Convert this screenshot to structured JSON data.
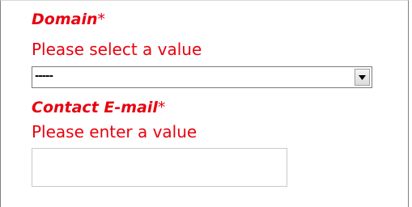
{
  "form": {
    "domain": {
      "label": "Domain",
      "required_mark": "*",
      "error": "Please select a value",
      "selected_value": "-----"
    },
    "contact_email": {
      "label": "Contact E-mail",
      "required_mark": "*",
      "error": "Please enter a value",
      "value": ""
    }
  },
  "colors": {
    "error_red": "#e8000f",
    "border_gray": "#7a7a7a"
  },
  "icons": {
    "dropdown": "chevron-down-icon"
  }
}
